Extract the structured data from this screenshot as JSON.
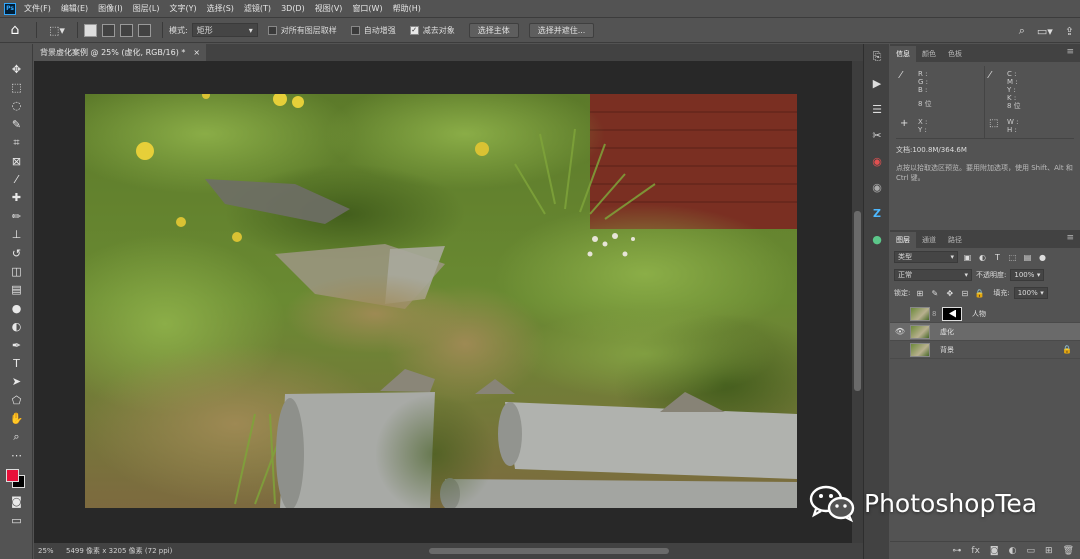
{
  "app": {
    "logo": "Ps"
  },
  "menu": [
    "文件(F)",
    "编辑(E)",
    "图像(I)",
    "图层(L)",
    "文字(Y)",
    "选择(S)",
    "滤镜(T)",
    "3D(D)",
    "视图(V)",
    "窗口(W)",
    "帮助(H)"
  ],
  "options": {
    "style_label": "模式:",
    "style_value": "矩形",
    "sample_all_label": "对所有图层取样",
    "auto_enhance_label": "自动增强",
    "subtract_label": "减去对象",
    "select_subject_btn": "选择主体",
    "select_mask_btn": "选择并遮住..."
  },
  "document": {
    "tab_title": "背景虚化案例 @ 25% (虚化, RGB/16) *",
    "close_glyph": "×",
    "zoom": "25%",
    "info": "5499 像素 x 3205 像素 (72 ppi)"
  },
  "info_panel": {
    "tabs": [
      "信息",
      "颜色",
      "色板"
    ],
    "rgb_labels": [
      "R :",
      "G :",
      "B :"
    ],
    "cmyk_labels": [
      "C :",
      "M :",
      "Y :",
      "K :"
    ],
    "bit_left": "8 位",
    "bit_right": "8 位",
    "xy_labels": [
      "X :",
      "Y :"
    ],
    "wh_labels": [
      "W :",
      "H :"
    ],
    "doc_size": "文档:100.8M/364.6M",
    "hint": "点按以拾取选区预览。要用附加选项，使用 Shift、Alt 和 Ctrl 键。"
  },
  "layers_panel": {
    "tabs": [
      "图层",
      "通道",
      "路径"
    ],
    "filter_kind": "类型",
    "blend_mode": "正常",
    "opacity_label": "不透明度:",
    "opacity_value": "100%",
    "lock_label": "锁定:",
    "fill_label": "填充:",
    "fill_value": "100%",
    "layers": [
      {
        "name": "人物",
        "visible": false,
        "has_mask": true,
        "selected": false,
        "locked": false
      },
      {
        "name": "虚化",
        "visible": true,
        "has_mask": false,
        "selected": true,
        "locked": false
      },
      {
        "name": "背景",
        "visible": false,
        "has_mask": false,
        "selected": false,
        "locked": true
      }
    ]
  },
  "watermark": {
    "text": "PhotoshopTea"
  },
  "colors": {
    "foreground": "#e8103a",
    "background": "#000000",
    "ui_bg": "#535353",
    "canvas_bg": "#282828"
  }
}
